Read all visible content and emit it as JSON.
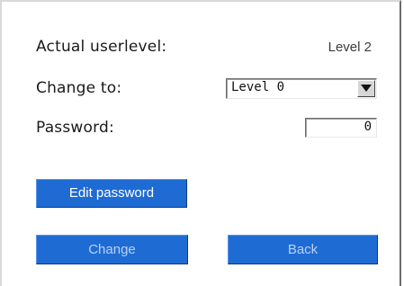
{
  "form": {
    "actual_label": "Actual userlevel:",
    "actual_value": "Level 2",
    "change_label": "Change to:",
    "change_value": "Level 0",
    "password_label": "Password:",
    "password_value": "0"
  },
  "buttons": {
    "edit_password": "Edit password",
    "change": "Change",
    "back": "Back"
  },
  "icons": {
    "dropdown": "triangle-down-icon"
  },
  "colors": {
    "button_bg": "#1f6bd4",
    "button_text": "#ffffff",
    "button_text_disabled": "#b9d2f3"
  }
}
